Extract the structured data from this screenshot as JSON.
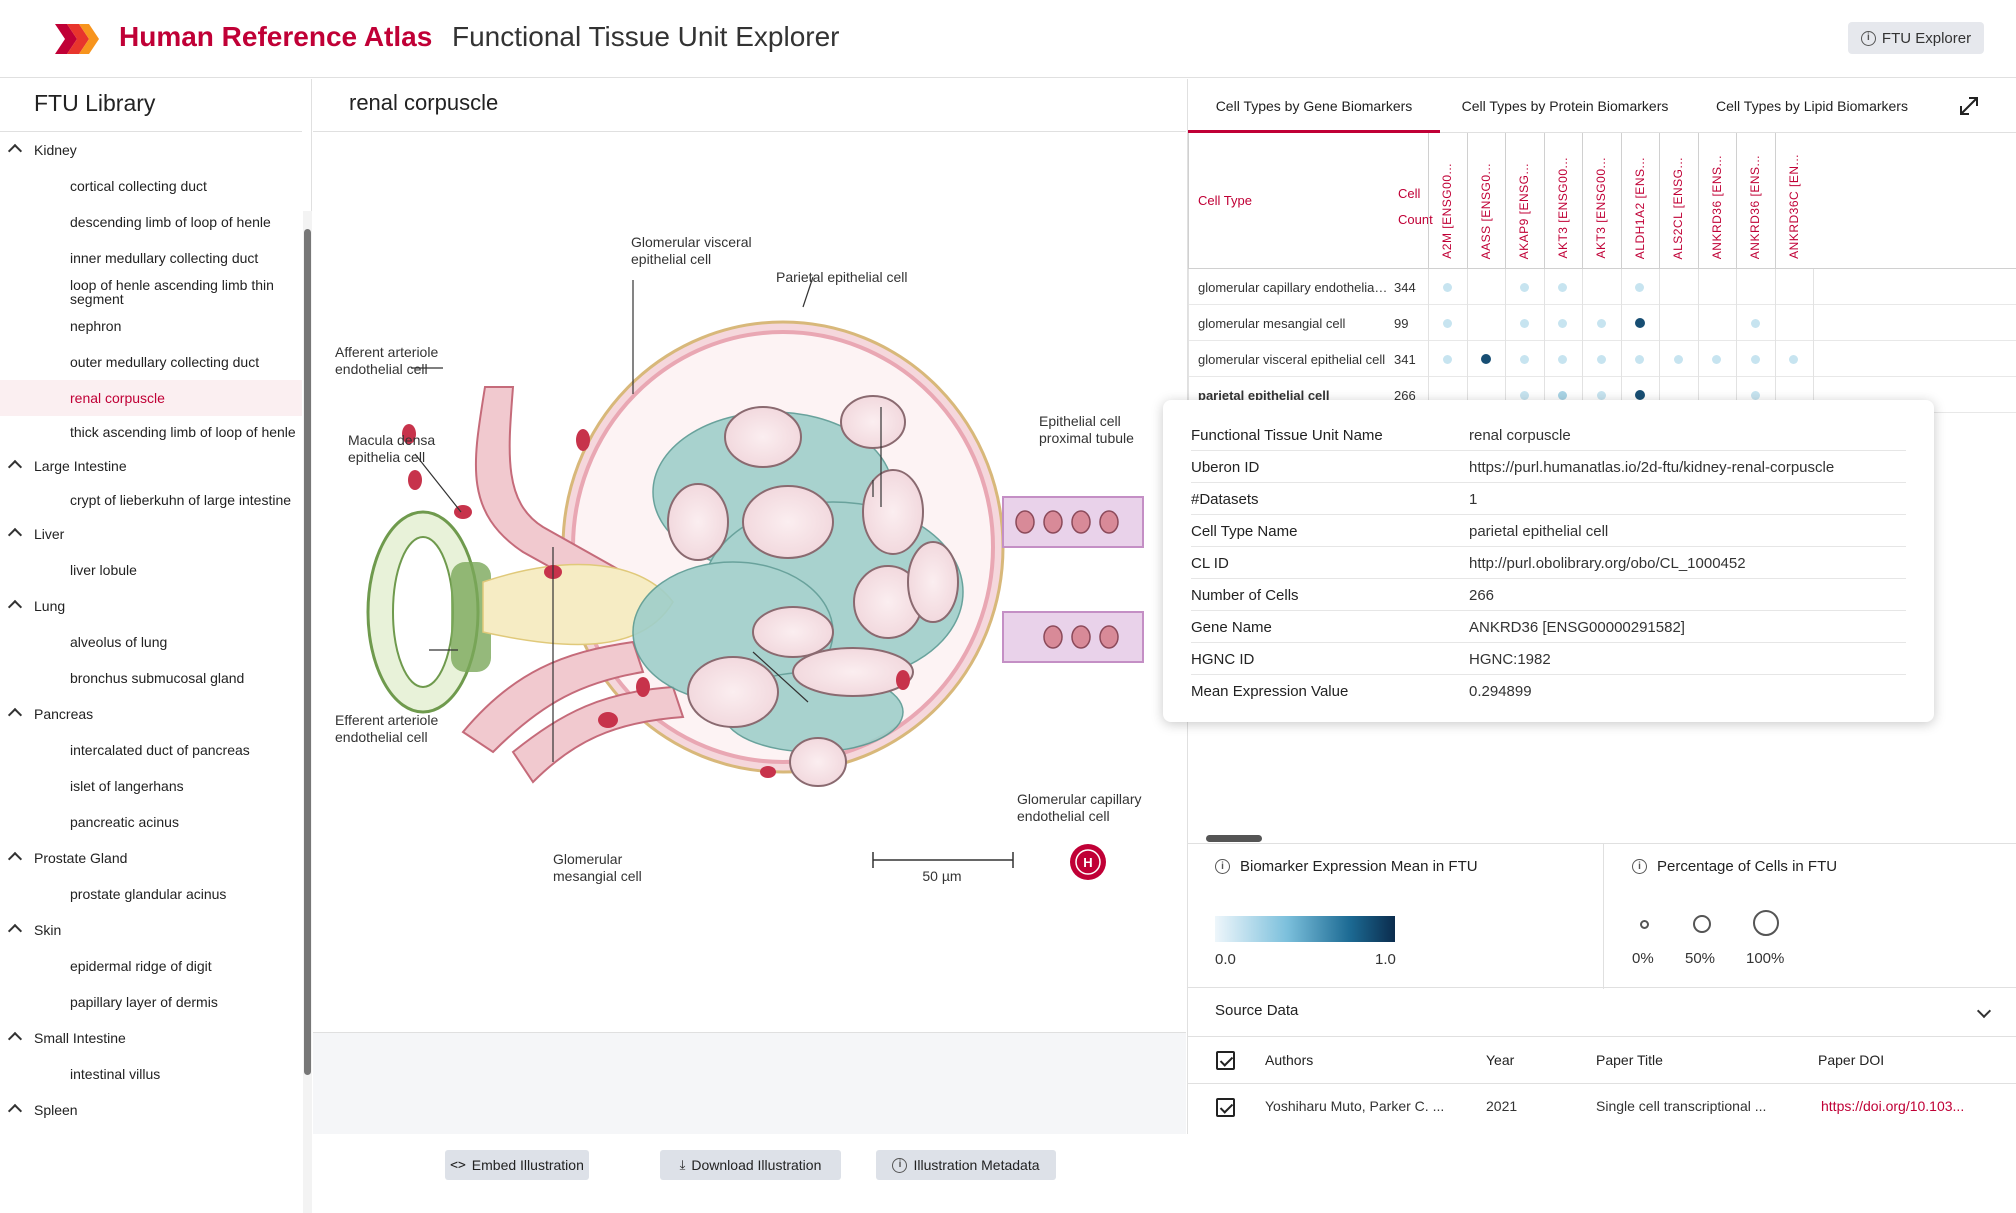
{
  "header": {
    "title": "Human Reference Atlas",
    "subtitle": "Functional Tissue Unit Explorer",
    "ftu_button": "FTU Explorer",
    "brand_color": "#c00036"
  },
  "sidebar": {
    "title": "FTU Library",
    "groups": [
      {
        "label": "Kidney",
        "items": [
          "cortical collecting duct",
          "descending limb of loop of henle",
          "inner medullary collecting duct",
          "loop of henle ascending limb thin segment",
          "nephron",
          "outer medullary collecting duct",
          "renal corpuscle",
          "thick ascending limb of loop of henle"
        ]
      },
      {
        "label": "Large Intestine",
        "items": [
          "crypt of lieberkuhn of large intestine"
        ]
      },
      {
        "label": "Liver",
        "items": [
          "liver lobule"
        ]
      },
      {
        "label": "Lung",
        "items": [
          "alveolus of lung",
          "bronchus submucosal gland"
        ]
      },
      {
        "label": "Pancreas",
        "items": [
          "intercalated duct of pancreas",
          "islet of langerhans",
          "pancreatic acinus"
        ]
      },
      {
        "label": "Prostate Gland",
        "items": [
          "prostate glandular acinus"
        ]
      },
      {
        "label": "Skin",
        "items": [
          "epidermal ridge of digit",
          "papillary layer of dermis"
        ]
      },
      {
        "label": "Small Intestine",
        "items": [
          "intestinal villus"
        ]
      },
      {
        "label": "Spleen",
        "items": []
      }
    ],
    "selected": "renal corpuscle"
  },
  "center": {
    "title": "renal corpuscle",
    "illustration_labels": {
      "glomerular_visceral": [
        "Glomerular visceral",
        "epithelial cell"
      ],
      "parietal": [
        "Parietal epithelial cell"
      ],
      "afferent": [
        "Afferent arteriole",
        "endothelial cell"
      ],
      "macula": [
        "Macula densa",
        "epithelia cell"
      ],
      "epithelial_prox": [
        "Epithelial cell",
        "proximal tubule"
      ],
      "efferent": [
        "Efferent arteriole",
        "endothelial cell"
      ],
      "glomerular_capillary": [
        "Glomerular capillary",
        "endothelial cell"
      ],
      "mesangial": [
        "Glomerular",
        "mesangial cell"
      ],
      "scale": "50 µm"
    },
    "buttons": {
      "embed": "Embed Illustration",
      "download": "Download Illustration",
      "metadata": "Illustration Metadata"
    }
  },
  "right": {
    "tabs": [
      "Cell Types by Gene Biomarkers",
      "Cell Types by Protein Biomarkers",
      "Cell Types by Lipid Biomarkers"
    ],
    "active_tab": 0,
    "table": {
      "col_cell_type": "Cell Type",
      "col_cell_count": [
        "Cell",
        "Count"
      ],
      "biomarkers": [
        "A2M [ENSG00...",
        "AASS [ENSG0...",
        "AKAP9 [ENSG...",
        "AKT3 [ENSG00...",
        "AKT3 [ENSG00...",
        "ALDH1A2 [ENS...",
        "ALS2CL [ENSG...",
        "ANKRD36 [ENS...",
        "ANKRD36 [ENS...",
        "ANKRD36C [EN..."
      ],
      "rows": [
        {
          "name": "glomerular capillary endothelial ...",
          "count": "344",
          "bold": false,
          "expr": [
            0.2,
            null,
            0.2,
            0.2,
            null,
            0.2,
            null,
            null,
            null,
            null
          ]
        },
        {
          "name": "glomerular mesangial cell",
          "count": "99",
          "bold": false,
          "expr": [
            0.15,
            null,
            0.15,
            0.15,
            0.15,
            0.95,
            null,
            null,
            0.15,
            null
          ]
        },
        {
          "name": "glomerular visceral epithelial cell",
          "count": "341",
          "bold": false,
          "expr": [
            0.2,
            0.9,
            0.2,
            0.2,
            0.2,
            0.2,
            0.15,
            0.15,
            0.2,
            0.15
          ]
        },
        {
          "name": "parietal epithelial cell",
          "count": "266",
          "bold": true,
          "expr": [
            null,
            null,
            0.2,
            0.3,
            0.2,
            0.95,
            null,
            null,
            0.25,
            null
          ]
        }
      ]
    },
    "tooltip": [
      {
        "k": "Functional Tissue Unit Name",
        "v": "renal corpuscle"
      },
      {
        "k": "Uberon ID",
        "v": "https://purl.humanatlas.io/2d-ftu/kidney-renal-corpuscle"
      },
      {
        "k": "#Datasets",
        "v": "1"
      },
      {
        "k": "Cell Type Name",
        "v": "parietal epithelial cell"
      },
      {
        "k": "CL ID",
        "v": "http://purl.obolibrary.org/obo/CL_1000452"
      },
      {
        "k": "Number of Cells",
        "v": "266"
      },
      {
        "k": "Gene Name",
        "v": "ANKRD36 [ENSG00000291582]"
      },
      {
        "k": "HGNC ID",
        "v": "HGNC:1982"
      },
      {
        "k": "Mean Expression Value",
        "v": "0.294899"
      }
    ],
    "legend": {
      "mean_title": "Biomarker Expression Mean in FTU",
      "pct_title": "Percentage of Cells in FTU",
      "min": "0.0",
      "max": "1.0",
      "pct_labels": [
        "0%",
        "50%",
        "100%"
      ]
    },
    "source": {
      "title": "Source Data",
      "headers": {
        "authors": "Authors",
        "year": "Year",
        "title": "Paper Title",
        "doi": "Paper DOI"
      },
      "row": {
        "authors": "Yoshiharu Muto, Parker C. ...",
        "year": "2021",
        "title": "Single cell transcriptional ...",
        "doi": "https://doi.org/10.103..."
      }
    }
  }
}
